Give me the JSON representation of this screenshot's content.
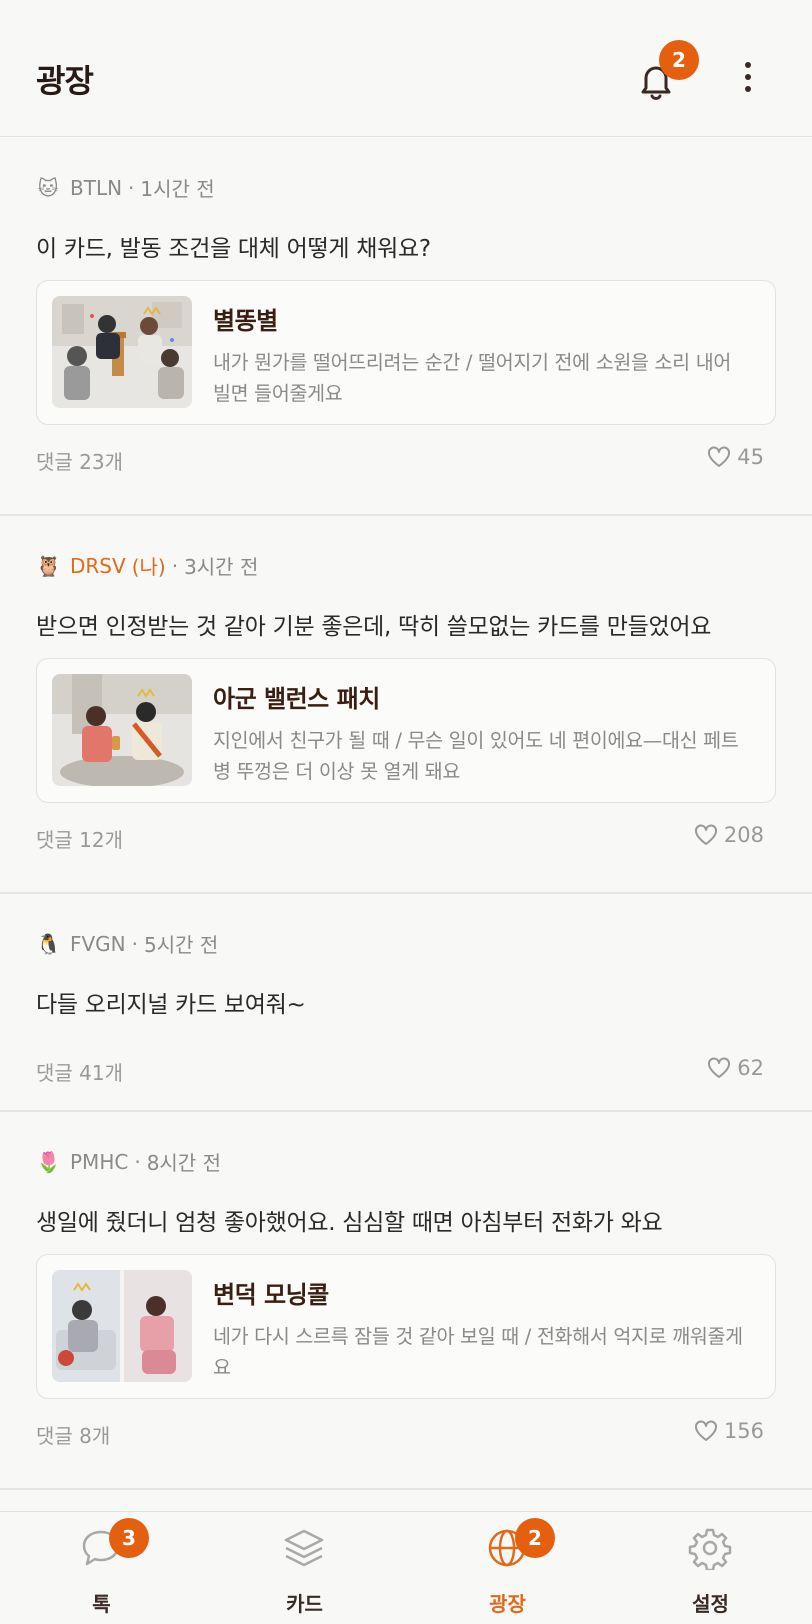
{
  "header": {
    "title": "광장",
    "notification_count": "2"
  },
  "posts": [
    {
      "avatar": "🐱",
      "author": "BTLN",
      "time": "1시간 전",
      "text": "이 카드, 발동 조건을 대체 어떻게 채워요?",
      "card": {
        "title": "별똥별",
        "desc": "내가 뭔가를 떨어뜨리려는 순간 / 떨어지기 전에 소원을 소리 내어 빌면 들어줄게요"
      },
      "comments": "댓글 23개",
      "likes": "45"
    },
    {
      "avatar": "🦉",
      "author": "DRSV",
      "me_tag": "(나)",
      "time": "3시간 전",
      "text": "받으면 인정받는 것 같아 기분 좋은데, 딱히 쓸모없는 카드를 만들었어요",
      "card": {
        "title": "아군 밸런스 패치",
        "desc": "지인에서 친구가 될 때 / 무슨 일이 있어도 네 편이에요—대신 페트병 뚜껑은 더 이상 못 열게 돼요"
      },
      "comments": "댓글 12개",
      "likes": "208"
    },
    {
      "avatar": "🐧",
      "author": "FVGN",
      "time": "5시간 전",
      "text": "다들 오리지널 카드 보여줘~",
      "comments": "댓글 41개",
      "likes": "62"
    },
    {
      "avatar": "🌷",
      "author": "PMHC",
      "time": "8시간 전",
      "text": "생일에 줬더니 엄청 좋아했어요. 심심할 때면 아침부터 전화가 와요",
      "card": {
        "title": "변덕 모닝콜",
        "desc": "네가 다시 스르륵 잠들 것 같아 보일 때 / 전화해서 억지로 깨워줄게요"
      },
      "comments": "댓글 8개",
      "likes": "156"
    }
  ],
  "meta_separator": "·",
  "nav": [
    {
      "label": "톡",
      "icon": "chat-bubble-icon",
      "badge": "3"
    },
    {
      "label": "카드",
      "icon": "layers-icon"
    },
    {
      "label": "광장",
      "icon": "globe-icon",
      "badge": "2",
      "active": true
    },
    {
      "label": "설정",
      "icon": "gear-icon"
    }
  ],
  "colors": {
    "accent": "#e4600f",
    "background": "#f8f8f7",
    "title": "#2a1a14",
    "muted": "#8a8a8a"
  }
}
